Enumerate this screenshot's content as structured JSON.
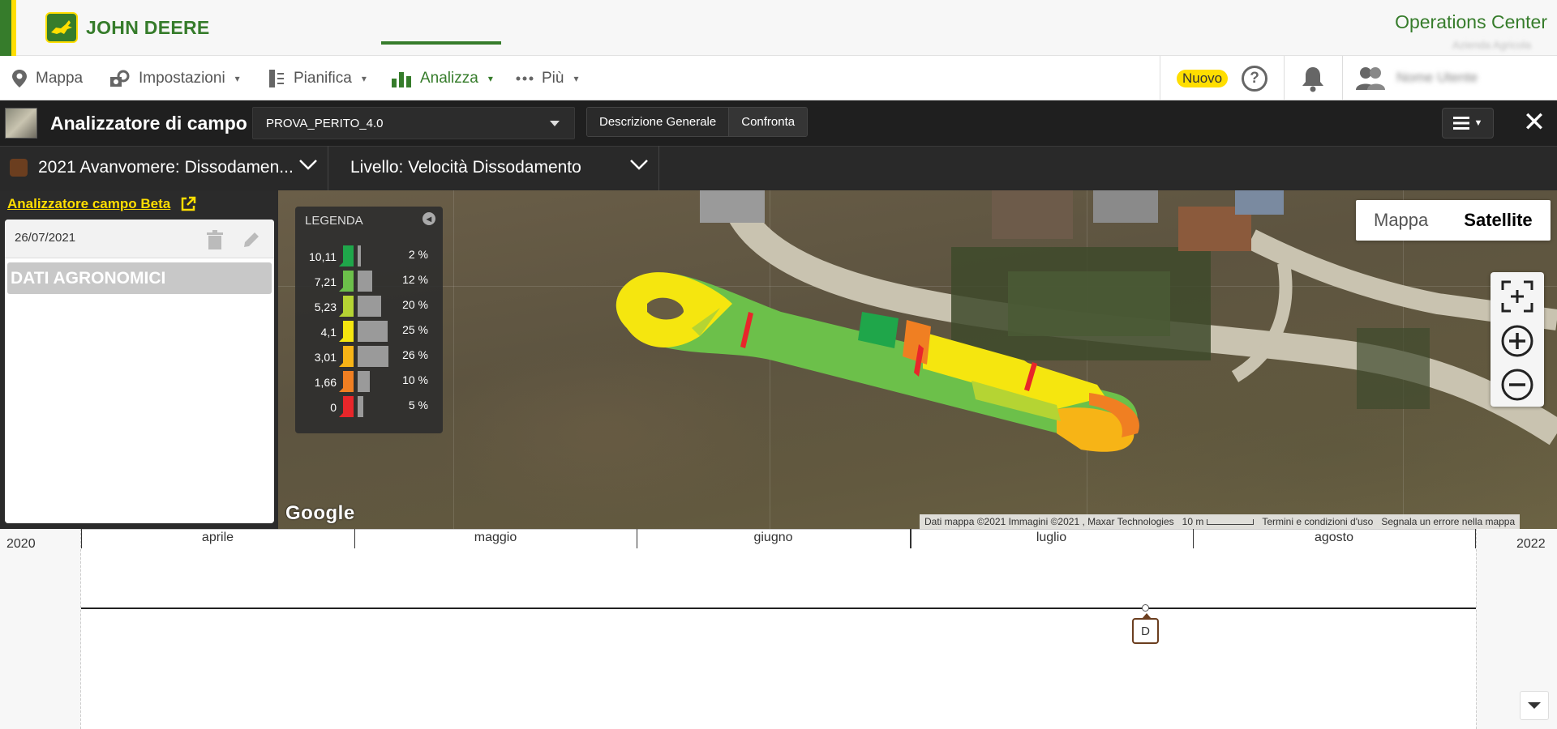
{
  "brand": {
    "logo_text": "JOHN DEERE",
    "app_name": "Operations Center",
    "org_name": "Azienda Agricola"
  },
  "nav": {
    "items": [
      {
        "label": "Mappa",
        "icon": "map-pin-icon"
      },
      {
        "label": "Impostazioni",
        "icon": "settings-gear-icon"
      },
      {
        "label": "Pianifica",
        "icon": "plan-icon"
      },
      {
        "label": "Analizza",
        "icon": "bar-chart-icon",
        "active": true
      },
      {
        "label": "Più",
        "icon": "more-dots-icon"
      }
    ],
    "nuovo_label": "Nuovo",
    "help_label": "?",
    "user_name": "Nome Utente"
  },
  "analyzer": {
    "title": "Analizzatore di campo",
    "field_selected": "PROVA_PERITO_4.0",
    "tab_overview": "Descrizione Generale",
    "tab_compare": "Confronta",
    "close_label": "✕"
  },
  "subheader": {
    "operation_label": "2021 Avanvomere: Dissodamen...",
    "operation_color": "#6b3e1f",
    "layer_label": "Livello: Velocità Dissodamento"
  },
  "left_panel": {
    "beta_link": "Analizzatore campo Beta",
    "date": "26/07/2021",
    "row_label": "DATI AGRONOMICI"
  },
  "legend": {
    "title": "LEGENDA",
    "rows": [
      {
        "value": "10,11",
        "pct": "2 %",
        "color": "#1fa64a",
        "fraction": 0.02
      },
      {
        "value": "7,21",
        "pct": "12 %",
        "color": "#6cc04a",
        "fraction": 0.12
      },
      {
        "value": "5,23",
        "pct": "20 %",
        "color": "#b5d433",
        "fraction": 0.2
      },
      {
        "value": "4,1",
        "pct": "25 %",
        "color": "#f5e60f",
        "fraction": 0.25
      },
      {
        "value": "3,01",
        "pct": "26 %",
        "color": "#f7b416",
        "fraction": 0.26
      },
      {
        "value": "1,66",
        "pct": "10 %",
        "color": "#f07f22",
        "fraction": 0.1
      },
      {
        "value": "0",
        "pct": "5 %",
        "color": "#e8262a",
        "fraction": 0.05
      }
    ]
  },
  "map": {
    "type_map": "Mappa",
    "type_satellite": "Satellite",
    "google": "Google",
    "attribution": "Dati mappa ©2021 Immagini ©2021 , Maxar Technologies",
    "scale": "10 m",
    "terms": "Termini e condizioni d'uso",
    "report": "Segnala un errore nella mappa"
  },
  "timeline": {
    "year_left": "2020",
    "year_right": "2022",
    "months": [
      "aprile",
      "maggio",
      "giugno",
      "luglio",
      "agosto"
    ],
    "marker_label": "D"
  }
}
